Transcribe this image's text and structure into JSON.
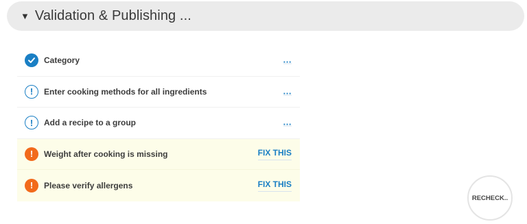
{
  "section": {
    "caret": "▼",
    "title": "Validation & Publishing ..."
  },
  "checks": [
    {
      "label": "Category",
      "status": "ok",
      "icon": "check-circle-icon",
      "action": "..."
    },
    {
      "label": "Enter cooking methods for all ingredients",
      "status": "info",
      "icon": "info-circle-icon",
      "action": "..."
    },
    {
      "label": "Add a recipe to a group",
      "status": "info",
      "icon": "info-circle-icon",
      "action": "..."
    },
    {
      "label": "Weight after cooking is missing",
      "status": "error",
      "icon": "alert-circle-icon",
      "action": "FIX THIS"
    },
    {
      "label": "Please verify allergens",
      "status": "error",
      "icon": "alert-circle-icon",
      "action": "FIX THIS"
    }
  ],
  "recheck_label": "RECHECK..",
  "colors": {
    "accent": "#1a7fc4",
    "error": "#f26a1b",
    "warn_row_bg": "#fdfde9",
    "header_bg": "#ebebeb"
  }
}
